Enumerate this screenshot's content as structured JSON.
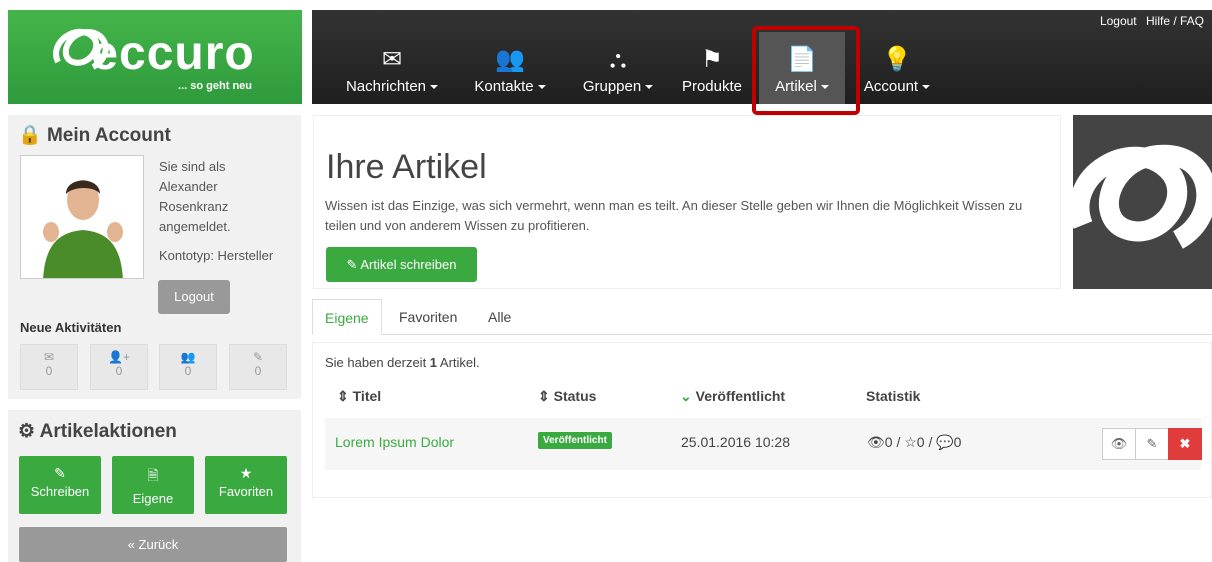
{
  "brand": {
    "name": "eccuro",
    "tagline": "... so geht neu"
  },
  "toplinks": {
    "logout": "Logout",
    "help": "Hilfe / FAQ"
  },
  "nav": [
    {
      "label": "Nachrichten",
      "icon": "envelope-icon",
      "glyph": "✉"
    },
    {
      "label": "Kontakte",
      "icon": "users-icon",
      "glyph": "👥"
    },
    {
      "label": "Gruppen",
      "icon": "group-network-icon",
      "glyph": "⛬"
    },
    {
      "label": "Produkte",
      "icon": "flag-icon",
      "glyph": "⚑"
    },
    {
      "label": "Artikel",
      "icon": "document-icon",
      "glyph": "📄"
    },
    {
      "label": "Account",
      "icon": "lightbulb-icon",
      "glyph": "💡"
    }
  ],
  "account": {
    "title": "Mein Account",
    "line1": "Sie sind als",
    "line2": "Alexander",
    "line3": "Rosenkranz",
    "line4": "angemeldet.",
    "type": "Kontotyp: Hersteller",
    "logout": "Logout"
  },
  "activities": {
    "title": "Neue Aktivitäten",
    "items": [
      {
        "icon": "envelope-icon",
        "glyph": "✉",
        "count": "0"
      },
      {
        "icon": "add-user-icon",
        "glyph": "👤+",
        "count": "0"
      },
      {
        "icon": "group-icon",
        "glyph": "👥",
        "count": "0"
      },
      {
        "icon": "edit-icon",
        "glyph": "✎",
        "count": "0"
      }
    ]
  },
  "actions": {
    "title": "Artikelaktionen",
    "write": "Schreiben",
    "own": "Eigene",
    "fav": "Favoriten",
    "back": "« Zurück"
  },
  "main": {
    "title": "Ihre Artikel",
    "text": "Wissen ist das Einzige, was sich vermehrt, wenn man es teilt. An dieser Stelle geben wir Ihnen die Möglichkeit Wissen zu teilen und von anderem Wissen zu profitieren.",
    "write_button": "Artikel schreiben"
  },
  "tabs": [
    "Eigene",
    "Favoriten",
    "Alle"
  ],
  "list": {
    "summary_pre": "Sie haben derzeit ",
    "summary_count": "1",
    "summary_post": " Artikel.",
    "headers": {
      "title": "Titel",
      "status": "Status",
      "published": "Veröffentlicht",
      "stats": "Statistik"
    },
    "rows": [
      {
        "title": "Lorem Ipsum Dolor",
        "status": "Veröffentlicht",
        "date": "25.01.2016 10:28",
        "stats": "👁0 / ☆0 / 💬0"
      }
    ]
  },
  "colors": {
    "green": "#3aaa40",
    "dark": "#262626",
    "highlight": "#c00000",
    "danger": "#e03c3c"
  }
}
